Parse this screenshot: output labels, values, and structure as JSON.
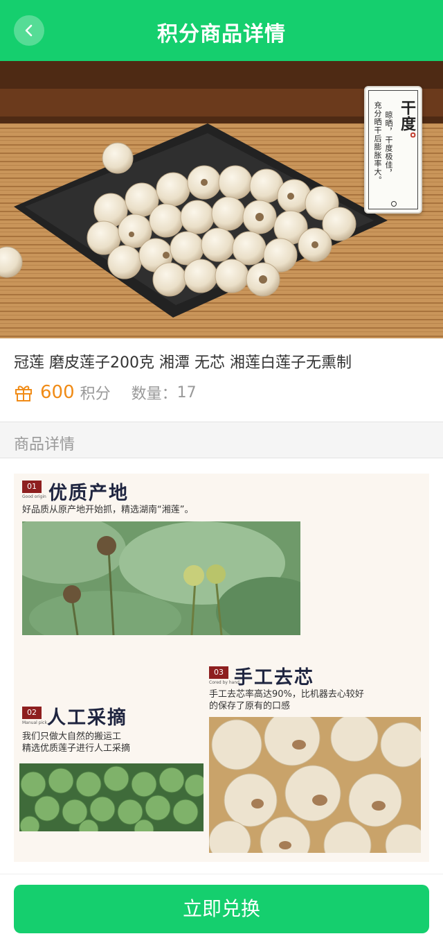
{
  "header": {
    "title": "积分商品详情",
    "back_icon": "chevron-left-icon",
    "background": "#15cf6e"
  },
  "hero": {
    "tag_main": "干度",
    "tag_dot": "。",
    "tag_line1": "晾晒，干度极佳，",
    "tag_line2": "充分晒干后膨胀率大。"
  },
  "product": {
    "name": "冠莲 磨皮莲子200克 湘潭 无芯 湘莲白莲子无熏制",
    "points": "600",
    "points_unit": "积分",
    "quantity_label": "数量：",
    "quantity": "17",
    "points_color": "#f08b16"
  },
  "details": {
    "section_title": "商品详情",
    "blocks": [
      {
        "num": "01",
        "num_sub": "Good origin",
        "heading": "优质产地",
        "text": [
          "好品质从原产地开始抓，精选湖南“湘莲”。"
        ]
      },
      {
        "num": "02",
        "num_sub": "Manual pick",
        "heading": "人工采摘",
        "text": [
          "我们只做大自然的搬运工",
          "精选优质莲子进行人工采摘"
        ]
      },
      {
        "num": "03",
        "num_sub": "Cored by hand",
        "heading": "手工去芯",
        "text": [
          "手工去芯率高达90%，比机器去心较好",
          "的保存了原有的口感"
        ]
      }
    ]
  },
  "footer": {
    "redeem_label": "立即兑换"
  }
}
